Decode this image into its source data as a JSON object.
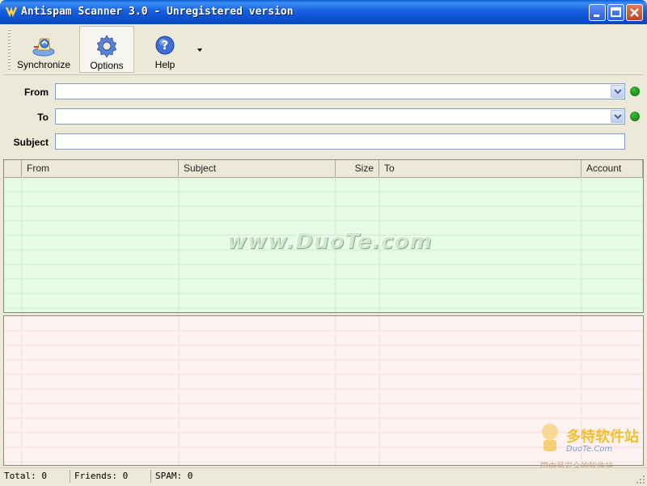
{
  "window": {
    "title": "Antispam Scanner 3.0 - Unregistered version"
  },
  "toolbar": {
    "synchronize_label": "Synchronize",
    "options_label": "Options",
    "help_label": "Help"
  },
  "filters": {
    "from_label": "From",
    "to_label": "To",
    "subject_label": "Subject",
    "from_value": "",
    "to_value": "",
    "subject_value": "",
    "status_color": "#0d7a0d"
  },
  "table": {
    "columns": [
      "From",
      "Subject",
      "Size",
      "To",
      "Account"
    ],
    "upper_bg": "#e6fbe6",
    "lower_bg": "#fff2f2"
  },
  "watermark": {
    "text": "www.DuoTe.com"
  },
  "corner_logo": {
    "title": "多特软件站",
    "url": "DuoTe.Com",
    "slogan": "国内最安全的软件站"
  },
  "statusbar": {
    "total": "Total: 0",
    "friends": "Friends: 0",
    "spam": "SPAM: 0"
  }
}
